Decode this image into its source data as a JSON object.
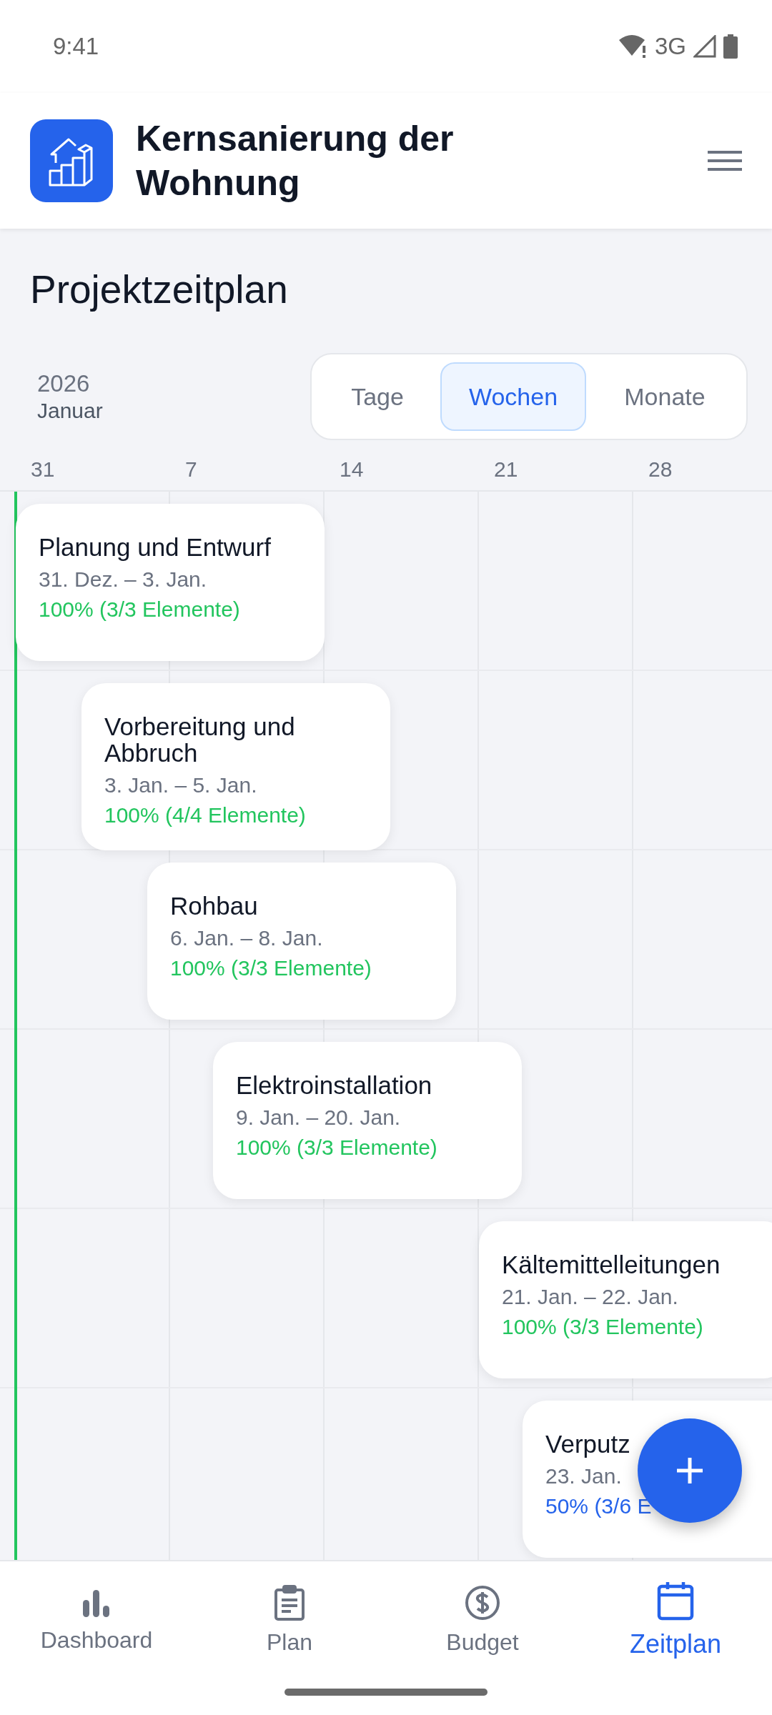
{
  "status_bar": {
    "time": "9:41",
    "network": "3G"
  },
  "header": {
    "title": "Kernsanierung der Wohnung"
  },
  "page_title": "Projektzeitplan",
  "period": {
    "year": "2026",
    "month": "Januar"
  },
  "view_tabs": [
    {
      "label": "Tage",
      "selected": false
    },
    {
      "label": "Wochen",
      "selected": true
    },
    {
      "label": "Monate",
      "selected": false
    }
  ],
  "week_labels": [
    "31",
    "7",
    "14",
    "21",
    "28"
  ],
  "phases": [
    {
      "title": "Planung und Entwurf",
      "dates": "31. Dez. – 3. Jan.",
      "progress": "100% (3/3 Elemente)",
      "complete": true
    },
    {
      "title": "Vorbereitung und Abbruch",
      "dates": "3. Jan. – 5. Jan.",
      "progress": "100% (4/4 Elemente)",
      "complete": true
    },
    {
      "title": "Rohbau",
      "dates": "6. Jan. – 8. Jan.",
      "progress": "100% (3/3 Elemente)",
      "complete": true
    },
    {
      "title": "Elektroinstallation",
      "dates": "9. Jan. – 20. Jan.",
      "progress": "100% (3/3 Elemente)",
      "complete": true
    },
    {
      "title": "Kältemittelleitungen",
      "dates": "21. Jan. – 22. Jan.",
      "progress": "100% (3/3 Elemente)",
      "complete": true
    },
    {
      "title": "Verputz",
      "dates": "23. Jan.",
      "progress": "50% (3/6 E",
      "complete": false
    }
  ],
  "bottom_nav": [
    {
      "label": "Dashboard",
      "kind": "chart",
      "selected": false
    },
    {
      "label": "Plan",
      "kind": "clipboard",
      "selected": false
    },
    {
      "label": "Budget",
      "kind": "dollar",
      "selected": false
    },
    {
      "label": "Zeitplan",
      "kind": "calendar",
      "selected": true
    }
  ]
}
